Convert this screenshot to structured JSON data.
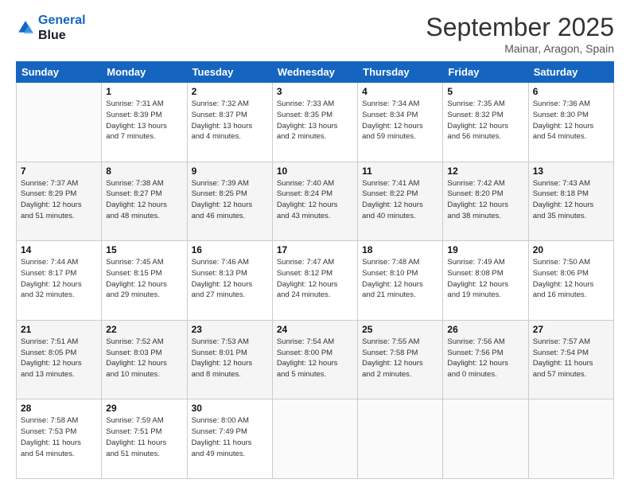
{
  "header": {
    "logo_line1": "General",
    "logo_line2": "Blue",
    "month": "September 2025",
    "location": "Mainar, Aragon, Spain"
  },
  "days_of_week": [
    "Sunday",
    "Monday",
    "Tuesday",
    "Wednesday",
    "Thursday",
    "Friday",
    "Saturday"
  ],
  "weeks": [
    [
      {
        "day": "",
        "info": ""
      },
      {
        "day": "1",
        "info": "Sunrise: 7:31 AM\nSunset: 8:39 PM\nDaylight: 13 hours\nand 7 minutes."
      },
      {
        "day": "2",
        "info": "Sunrise: 7:32 AM\nSunset: 8:37 PM\nDaylight: 13 hours\nand 4 minutes."
      },
      {
        "day": "3",
        "info": "Sunrise: 7:33 AM\nSunset: 8:35 PM\nDaylight: 13 hours\nand 2 minutes."
      },
      {
        "day": "4",
        "info": "Sunrise: 7:34 AM\nSunset: 8:34 PM\nDaylight: 12 hours\nand 59 minutes."
      },
      {
        "day": "5",
        "info": "Sunrise: 7:35 AM\nSunset: 8:32 PM\nDaylight: 12 hours\nand 56 minutes."
      },
      {
        "day": "6",
        "info": "Sunrise: 7:36 AM\nSunset: 8:30 PM\nDaylight: 12 hours\nand 54 minutes."
      }
    ],
    [
      {
        "day": "7",
        "info": "Sunrise: 7:37 AM\nSunset: 8:29 PM\nDaylight: 12 hours\nand 51 minutes."
      },
      {
        "day": "8",
        "info": "Sunrise: 7:38 AM\nSunset: 8:27 PM\nDaylight: 12 hours\nand 48 minutes."
      },
      {
        "day": "9",
        "info": "Sunrise: 7:39 AM\nSunset: 8:25 PM\nDaylight: 12 hours\nand 46 minutes."
      },
      {
        "day": "10",
        "info": "Sunrise: 7:40 AM\nSunset: 8:24 PM\nDaylight: 12 hours\nand 43 minutes."
      },
      {
        "day": "11",
        "info": "Sunrise: 7:41 AM\nSunset: 8:22 PM\nDaylight: 12 hours\nand 40 minutes."
      },
      {
        "day": "12",
        "info": "Sunrise: 7:42 AM\nSunset: 8:20 PM\nDaylight: 12 hours\nand 38 minutes."
      },
      {
        "day": "13",
        "info": "Sunrise: 7:43 AM\nSunset: 8:18 PM\nDaylight: 12 hours\nand 35 minutes."
      }
    ],
    [
      {
        "day": "14",
        "info": "Sunrise: 7:44 AM\nSunset: 8:17 PM\nDaylight: 12 hours\nand 32 minutes."
      },
      {
        "day": "15",
        "info": "Sunrise: 7:45 AM\nSunset: 8:15 PM\nDaylight: 12 hours\nand 29 minutes."
      },
      {
        "day": "16",
        "info": "Sunrise: 7:46 AM\nSunset: 8:13 PM\nDaylight: 12 hours\nand 27 minutes."
      },
      {
        "day": "17",
        "info": "Sunrise: 7:47 AM\nSunset: 8:12 PM\nDaylight: 12 hours\nand 24 minutes."
      },
      {
        "day": "18",
        "info": "Sunrise: 7:48 AM\nSunset: 8:10 PM\nDaylight: 12 hours\nand 21 minutes."
      },
      {
        "day": "19",
        "info": "Sunrise: 7:49 AM\nSunset: 8:08 PM\nDaylight: 12 hours\nand 19 minutes."
      },
      {
        "day": "20",
        "info": "Sunrise: 7:50 AM\nSunset: 8:06 PM\nDaylight: 12 hours\nand 16 minutes."
      }
    ],
    [
      {
        "day": "21",
        "info": "Sunrise: 7:51 AM\nSunset: 8:05 PM\nDaylight: 12 hours\nand 13 minutes."
      },
      {
        "day": "22",
        "info": "Sunrise: 7:52 AM\nSunset: 8:03 PM\nDaylight: 12 hours\nand 10 minutes."
      },
      {
        "day": "23",
        "info": "Sunrise: 7:53 AM\nSunset: 8:01 PM\nDaylight: 12 hours\nand 8 minutes."
      },
      {
        "day": "24",
        "info": "Sunrise: 7:54 AM\nSunset: 8:00 PM\nDaylight: 12 hours\nand 5 minutes."
      },
      {
        "day": "25",
        "info": "Sunrise: 7:55 AM\nSunset: 7:58 PM\nDaylight: 12 hours\nand 2 minutes."
      },
      {
        "day": "26",
        "info": "Sunrise: 7:56 AM\nSunset: 7:56 PM\nDaylight: 12 hours\nand 0 minutes."
      },
      {
        "day": "27",
        "info": "Sunrise: 7:57 AM\nSunset: 7:54 PM\nDaylight: 11 hours\nand 57 minutes."
      }
    ],
    [
      {
        "day": "28",
        "info": "Sunrise: 7:58 AM\nSunset: 7:53 PM\nDaylight: 11 hours\nand 54 minutes."
      },
      {
        "day": "29",
        "info": "Sunrise: 7:59 AM\nSunset: 7:51 PM\nDaylight: 11 hours\nand 51 minutes."
      },
      {
        "day": "30",
        "info": "Sunrise: 8:00 AM\nSunset: 7:49 PM\nDaylight: 11 hours\nand 49 minutes."
      },
      {
        "day": "",
        "info": ""
      },
      {
        "day": "",
        "info": ""
      },
      {
        "day": "",
        "info": ""
      },
      {
        "day": "",
        "info": ""
      }
    ]
  ]
}
